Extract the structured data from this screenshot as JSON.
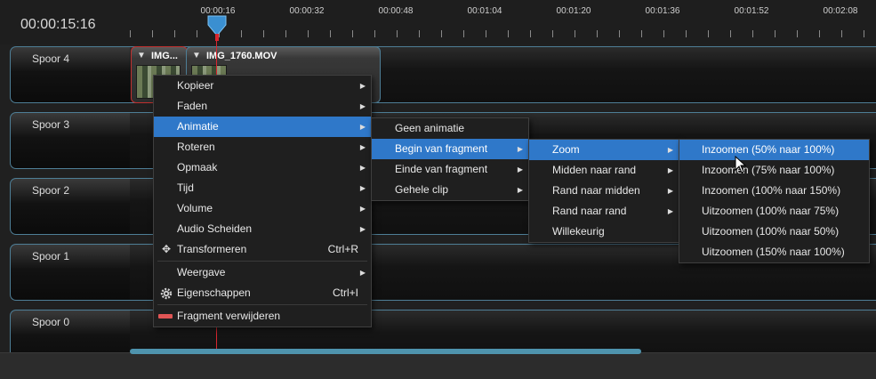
{
  "timecode": "00:00:15:16",
  "ruler_labels": [
    "00:00:16",
    "00:00:32",
    "00:00:48",
    "00:01:04",
    "00:01:20",
    "00:01:36",
    "00:01:52",
    "00:02:08"
  ],
  "tracks": [
    {
      "name": "Spoor 4"
    },
    {
      "name": "Spoor 3"
    },
    {
      "name": "Spoor 2"
    },
    {
      "name": "Spoor 1"
    },
    {
      "name": "Spoor 0"
    }
  ],
  "clips": [
    {
      "title": "IMG..."
    },
    {
      "title": "IMG_1760.MOV"
    }
  ],
  "context_menu": {
    "items": [
      {
        "label": "Kopieer",
        "has_submenu": true
      },
      {
        "label": "Faden",
        "has_submenu": true
      },
      {
        "label": "Animatie",
        "has_submenu": true,
        "highlighted": true
      },
      {
        "label": "Roteren",
        "has_submenu": true
      },
      {
        "label": "Opmaak",
        "has_submenu": true
      },
      {
        "label": "Tijd",
        "has_submenu": true
      },
      {
        "label": "Volume",
        "has_submenu": true
      },
      {
        "label": "Audio Scheiden",
        "has_submenu": true
      },
      {
        "label": "Transformeren",
        "shortcut": "Ctrl+R",
        "icon": "move-icon"
      },
      {
        "label": "Weergave",
        "has_submenu": true
      },
      {
        "label": "Eigenschappen",
        "shortcut": "Ctrl+I",
        "icon": "gear-icon"
      },
      {
        "label": "Fragment verwijderen",
        "icon": "remove-icon"
      }
    ]
  },
  "animation_menu": {
    "items": [
      {
        "label": "Geen animatie"
      },
      {
        "label": "Begin van fragment",
        "has_submenu": true,
        "highlighted": true
      },
      {
        "label": "Einde van fragment",
        "has_submenu": true
      },
      {
        "label": "Gehele clip",
        "has_submenu": true
      }
    ]
  },
  "fragment_menu": {
    "items": [
      {
        "label": "Zoom",
        "has_submenu": true,
        "highlighted": true
      },
      {
        "label": "Midden naar rand",
        "has_submenu": true
      },
      {
        "label": "Rand naar midden",
        "has_submenu": true
      },
      {
        "label": "Rand naar rand",
        "has_submenu": true
      },
      {
        "label": "Willekeurig"
      }
    ]
  },
  "zoom_menu": {
    "items": [
      {
        "label": "Inzoomen (50% naar 100%)",
        "highlighted": true
      },
      {
        "label": "Inzoomen (75% naar 100%)"
      },
      {
        "label": "Inzoomen (100% naar 150%)"
      },
      {
        "label": "Uitzoomen (100% naar 75%)"
      },
      {
        "label": "Uitzoomen (100% naar 50%)"
      },
      {
        "label": "Uitzoomen (150% naar 100%)"
      }
    ]
  },
  "colors": {
    "highlight": "#2f78c9",
    "track_border": "#4e7e96",
    "playhead": "#d8262f",
    "scrollbar": "#4e93ad"
  }
}
